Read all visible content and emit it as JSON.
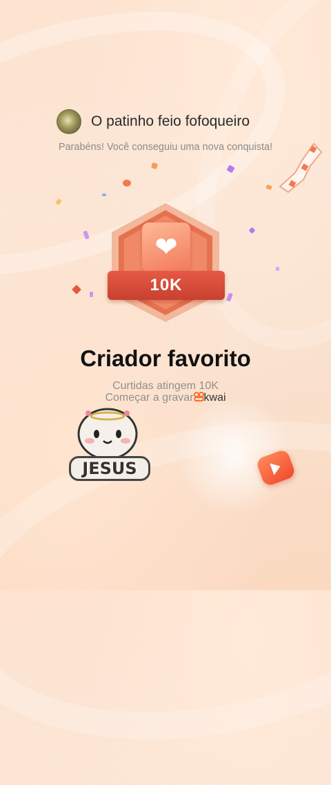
{
  "user": {
    "name": "O patinho feio fofoqueiro",
    "avatar_icon": "duck-avatar"
  },
  "subtitle": "Parabéns! Você conseguiu uma nova conquista!",
  "badge": {
    "icon": "heart-icon",
    "label": "10K"
  },
  "achievement": {
    "title": "Criador favorito",
    "line1": "Curtidas atingem 10K",
    "line2_prefix": "Começar a gravar",
    "brand_name": "kwai"
  },
  "sticker": {
    "label": "JESUS"
  },
  "colors": {
    "accent": "#e4523f",
    "brand": "#ff6a2b",
    "background": "#fbe3d2"
  }
}
